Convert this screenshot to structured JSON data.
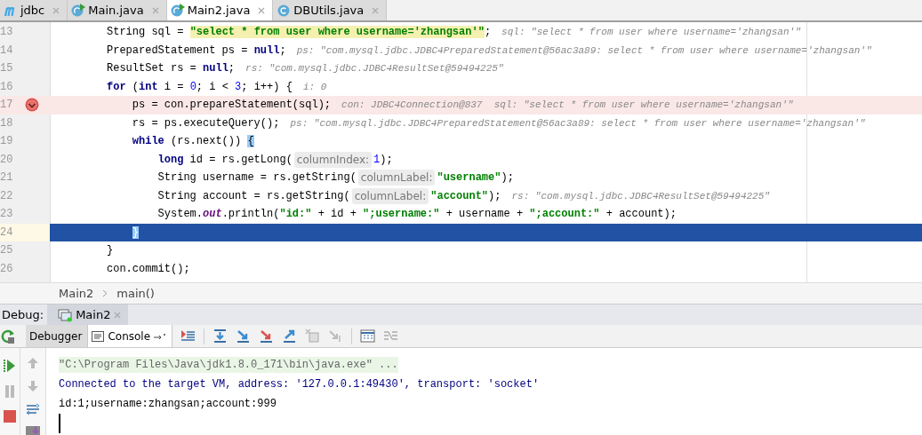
{
  "tabs": [
    {
      "label": "jdbc",
      "kind": "module",
      "selected": false
    },
    {
      "label": "Main.java",
      "kind": "runnable-class",
      "selected": false
    },
    {
      "label": "Main2.java",
      "kind": "runnable-class",
      "selected": true
    },
    {
      "label": "DBUtils.java",
      "kind": "class",
      "selected": false
    }
  ],
  "editor": {
    "lines": [
      {
        "number": "13",
        "breakpoint": false,
        "current": false,
        "segments": [
          {
            "kind": "plain",
            "text": "String sql = "
          },
          {
            "kind": "string-found",
            "text": "\"select * from user where username='zhangsan'\""
          },
          {
            "kind": "plain",
            "text": ";"
          },
          {
            "kind": "inlay",
            "text": "sql: \"select * from user where username='zhangsan'\""
          }
        ]
      },
      {
        "number": "14",
        "breakpoint": false,
        "current": false,
        "segments": [
          {
            "kind": "plain",
            "text": "PreparedStatement ps = "
          },
          {
            "kind": "keyword",
            "text": "null"
          },
          {
            "kind": "plain",
            "text": ";"
          },
          {
            "kind": "inlay",
            "text": "ps: \"com.mysql.jdbc.JDBC4PreparedStatement@56ac3a89: select * from user where username='zhangsan'\""
          }
        ]
      },
      {
        "number": "15",
        "breakpoint": false,
        "current": false,
        "segments": [
          {
            "kind": "plain",
            "text": "ResultSet rs = "
          },
          {
            "kind": "keyword",
            "text": "null"
          },
          {
            "kind": "plain",
            "text": ";"
          },
          {
            "kind": "inlay",
            "text": "rs: \"com.mysql.jdbc.JDBC4ResultSet@59494225\""
          }
        ]
      },
      {
        "number": "16",
        "breakpoint": false,
        "current": false,
        "segments": [
          {
            "kind": "keyword",
            "text": "for"
          },
          {
            "kind": "plain",
            "text": " ("
          },
          {
            "kind": "keyword",
            "text": "int"
          },
          {
            "kind": "plain",
            "text": " i = "
          },
          {
            "kind": "number",
            "text": "0"
          },
          {
            "kind": "plain",
            "text": "; i < "
          },
          {
            "kind": "number",
            "text": "3"
          },
          {
            "kind": "plain",
            "text": "; i++) {"
          },
          {
            "kind": "inlay",
            "text": "i: 0"
          }
        ],
        "children": [
          {
            "number": "17",
            "breakpoint": true,
            "current": false,
            "segments": [
              {
                "kind": "plain",
                "text": "ps = con.prepareStatement(sql);"
              },
              {
                "kind": "inlay",
                "text": "con: JDBC4Connection@837  sql: \"select * from user where username='zhangsan'\""
              }
            ]
          },
          {
            "number": "18",
            "breakpoint": false,
            "current": false,
            "segments": [
              {
                "kind": "plain",
                "text": "rs = ps.executeQuery();"
              },
              {
                "kind": "inlay",
                "text": "ps: \"com.mysql.jdbc.JDBC4PreparedStatement@56ac3a89: select * from user where username='zhangsan'\""
              }
            ]
          },
          {
            "number": "19",
            "breakpoint": false,
            "current": false,
            "segments": [
              {
                "kind": "keyword",
                "text": "while"
              },
              {
                "kind": "plain",
                "text": " (rs.next()) "
              },
              {
                "kind": "brace",
                "text": "{"
              }
            ],
            "children": [
              {
                "number": "20",
                "breakpoint": false,
                "current": false,
                "segments": [
                  {
                    "kind": "keyword",
                    "text": "long"
                  },
                  {
                    "kind": "plain",
                    "text": " id = rs.getLong("
                  },
                  {
                    "kind": "hint",
                    "text": "columnIndex:"
                  },
                  {
                    "kind": "number",
                    "text": "1"
                  },
                  {
                    "kind": "plain",
                    "text": ");"
                  }
                ]
              },
              {
                "number": "21",
                "breakpoint": false,
                "current": false,
                "segments": [
                  {
                    "kind": "plain",
                    "text": "String username = rs.getString("
                  },
                  {
                    "kind": "hint",
                    "text": "columnLabel:"
                  },
                  {
                    "kind": "string",
                    "text": "\"username\""
                  },
                  {
                    "kind": "plain",
                    "text": ");"
                  }
                ]
              },
              {
                "number": "22",
                "breakpoint": false,
                "current": false,
                "segments": [
                  {
                    "kind": "plain",
                    "text": "String account = rs.getString("
                  },
                  {
                    "kind": "hint",
                    "text": "columnLabel:"
                  },
                  {
                    "kind": "string",
                    "text": "\"account\""
                  },
                  {
                    "kind": "plain",
                    "text": ");"
                  },
                  {
                    "kind": "inlay",
                    "text": "rs: \"com.mysql.jdbc.JDBC4ResultSet@59494225\""
                  }
                ]
              },
              {
                "number": "23",
                "breakpoint": false,
                "current": false,
                "segments": [
                  {
                    "kind": "plain",
                    "text": "System."
                  },
                  {
                    "kind": "field",
                    "text": "out"
                  },
                  {
                    "kind": "plain",
                    "text": ".println("
                  },
                  {
                    "kind": "string",
                    "text": "\"id:\""
                  },
                  {
                    "kind": "plain",
                    "text": " + id + "
                  },
                  {
                    "kind": "string",
                    "text": "\";username:\""
                  },
                  {
                    "kind": "plain",
                    "text": " + username + "
                  },
                  {
                    "kind": "string",
                    "text": "\";account:\""
                  },
                  {
                    "kind": "plain",
                    "text": " + account);"
                  }
                ]
              }
            ]
          },
          {
            "number": "24",
            "breakpoint": false,
            "current": true,
            "segments": [
              {
                "kind": "brace",
                "text": "}"
              }
            ]
          }
        ]
      },
      {
        "number": "25",
        "breakpoint": false,
        "current": false,
        "segments": [
          {
            "kind": "plain",
            "text": "}"
          }
        ]
      },
      {
        "number": "26",
        "breakpoint": false,
        "current": false,
        "segments": [
          {
            "kind": "plain",
            "text": "con.commit();"
          }
        ]
      }
    ]
  },
  "breadcrumbs": [
    "Main2",
    "main()"
  ],
  "debug": {
    "label": "Debug:",
    "session": "Main2",
    "tabs": [
      {
        "label": "Debugger",
        "selected": false
      },
      {
        "label": "Console",
        "selected": true
      }
    ],
    "console": [
      {
        "kind": "command",
        "text": "\"C:\\Program Files\\Java\\jdk1.8.0_171\\bin\\java.exe\" ..."
      },
      {
        "kind": "system",
        "text": "Connected to the target VM, address: '127.0.0.1:49430', transport: 'socket'"
      },
      {
        "kind": "output",
        "text": "id:1;username:zhangsan;account:999"
      }
    ]
  }
}
